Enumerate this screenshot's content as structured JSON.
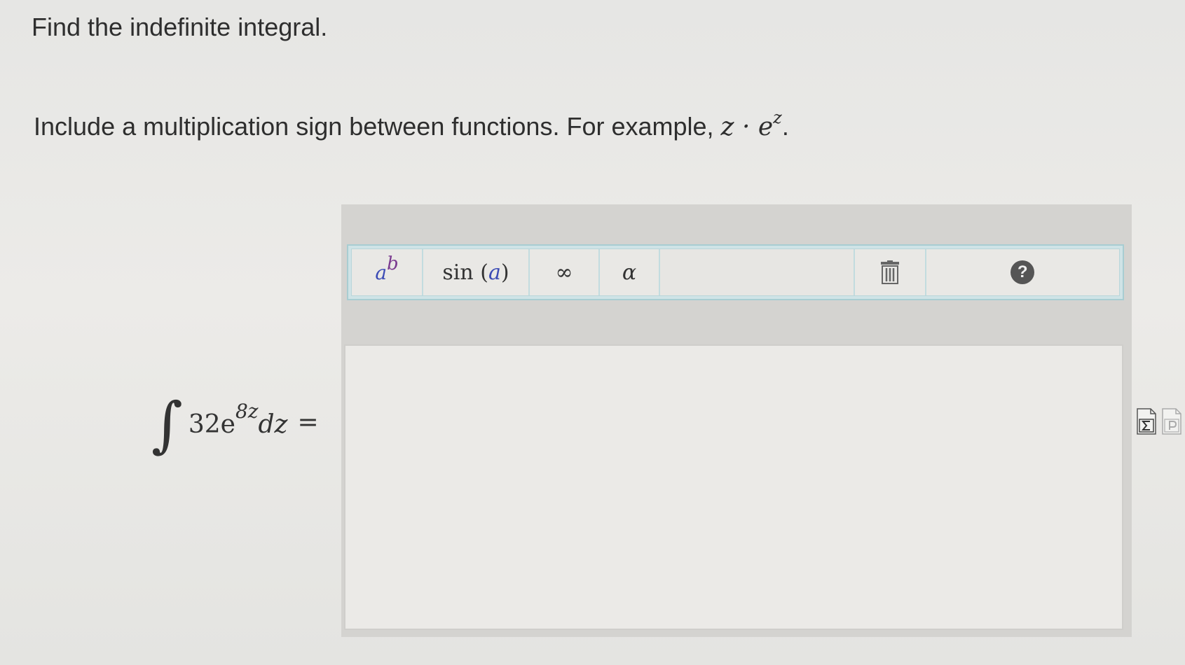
{
  "question": {
    "title": "Find the indefinite integral.",
    "instruction_text": "Include a multiplication sign between functions. For example,",
    "example_math": {
      "left": "z · e",
      "exponent": "z",
      "end": "."
    }
  },
  "problem": {
    "integral_symbol": "∫",
    "coefficient": "32e",
    "exponent": "8z",
    "differential": "dz",
    "equals": "="
  },
  "toolbar": {
    "superscript": {
      "base": "a",
      "exponent": "b"
    },
    "sin": {
      "func": "sin",
      "open": "(",
      "arg": "a",
      "close": ")"
    },
    "infinity": "∞",
    "alpha": "α",
    "help": "?"
  },
  "icons": {
    "trash": "trash-icon",
    "help": "help-icon",
    "equation_editor": "equation-editor-icon",
    "preview": "preview-icon"
  },
  "colors": {
    "toolbar_border": "#a8cdd2",
    "variable_blue": "#3b4bb5",
    "exponent_purple": "#7a3a8f",
    "panel_gray": "#d4d3d0"
  }
}
